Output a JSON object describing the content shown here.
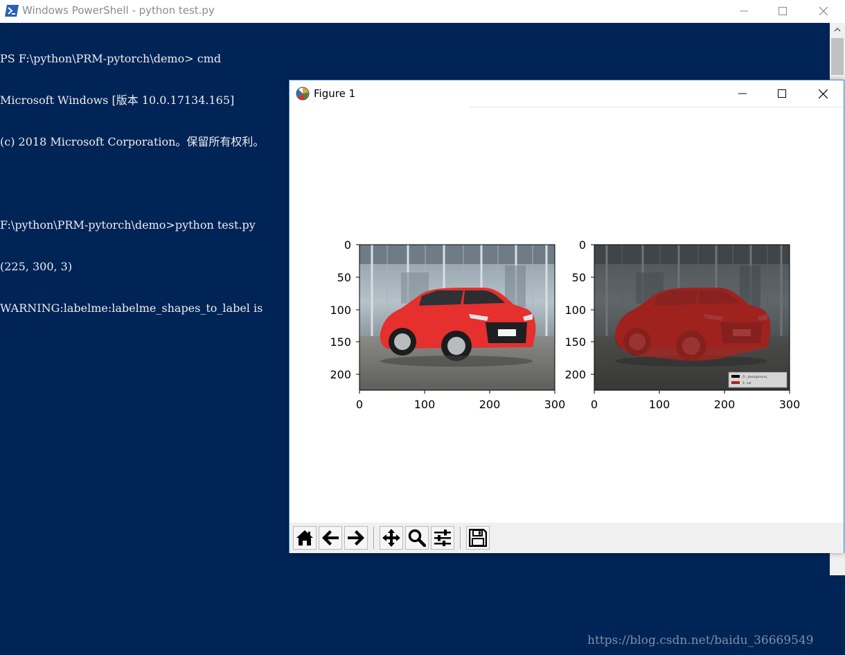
{
  "powershell": {
    "title": "Windows PowerShell - python  test.py",
    "lines": [
      "PS F:\\python\\PRM-pytorch\\demo> cmd",
      "Microsoft Windows [版本 10.0.17134.165]",
      "(c) 2018 Microsoft Corporation。保留所有权利。",
      "",
      "F:\\python\\PRM-pytorch\\demo>python test.py",
      "(225, 300, 3)",
      "WARNING:labelme:labelme_shapes_to_label is"
    ],
    "colors": {
      "background": "#012456",
      "text": "#eeedf0"
    },
    "controls": {
      "minimize_icon": "minimize-icon",
      "maximize_icon": "maximize-icon",
      "close_icon": "close-icon"
    }
  },
  "figure": {
    "title": "Figure 1",
    "plots": [
      {
        "name": "original-image",
        "y_ticks": [
          "0",
          "50",
          "100",
          "150",
          "200"
        ],
        "x_ticks": [
          "0",
          "100",
          "200",
          "300"
        ],
        "content": "photo of red hatchback car in front of glass building"
      },
      {
        "name": "label-overlay",
        "y_ticks": [
          "0",
          "50",
          "100",
          "150",
          "200"
        ],
        "x_ticks": [
          "0",
          "100",
          "200",
          "300"
        ],
        "content": "same photo darkened with red segmentation mask over the car",
        "legend": [
          "0: _background_",
          "1: car"
        ]
      }
    ],
    "toolbar": [
      {
        "name": "home-button",
        "icon": "home-icon"
      },
      {
        "name": "back-button",
        "icon": "arrow-left-icon"
      },
      {
        "name": "forward-button",
        "icon": "arrow-right-icon"
      },
      {
        "name": "pan-button",
        "icon": "move-icon"
      },
      {
        "name": "zoom-button",
        "icon": "magnifier-icon"
      },
      {
        "name": "configure-subplots-button",
        "icon": "sliders-icon"
      },
      {
        "name": "save-button",
        "icon": "floppy-disk-icon"
      }
    ]
  },
  "watermark": "https://blog.csdn.net/baidu_36669549"
}
